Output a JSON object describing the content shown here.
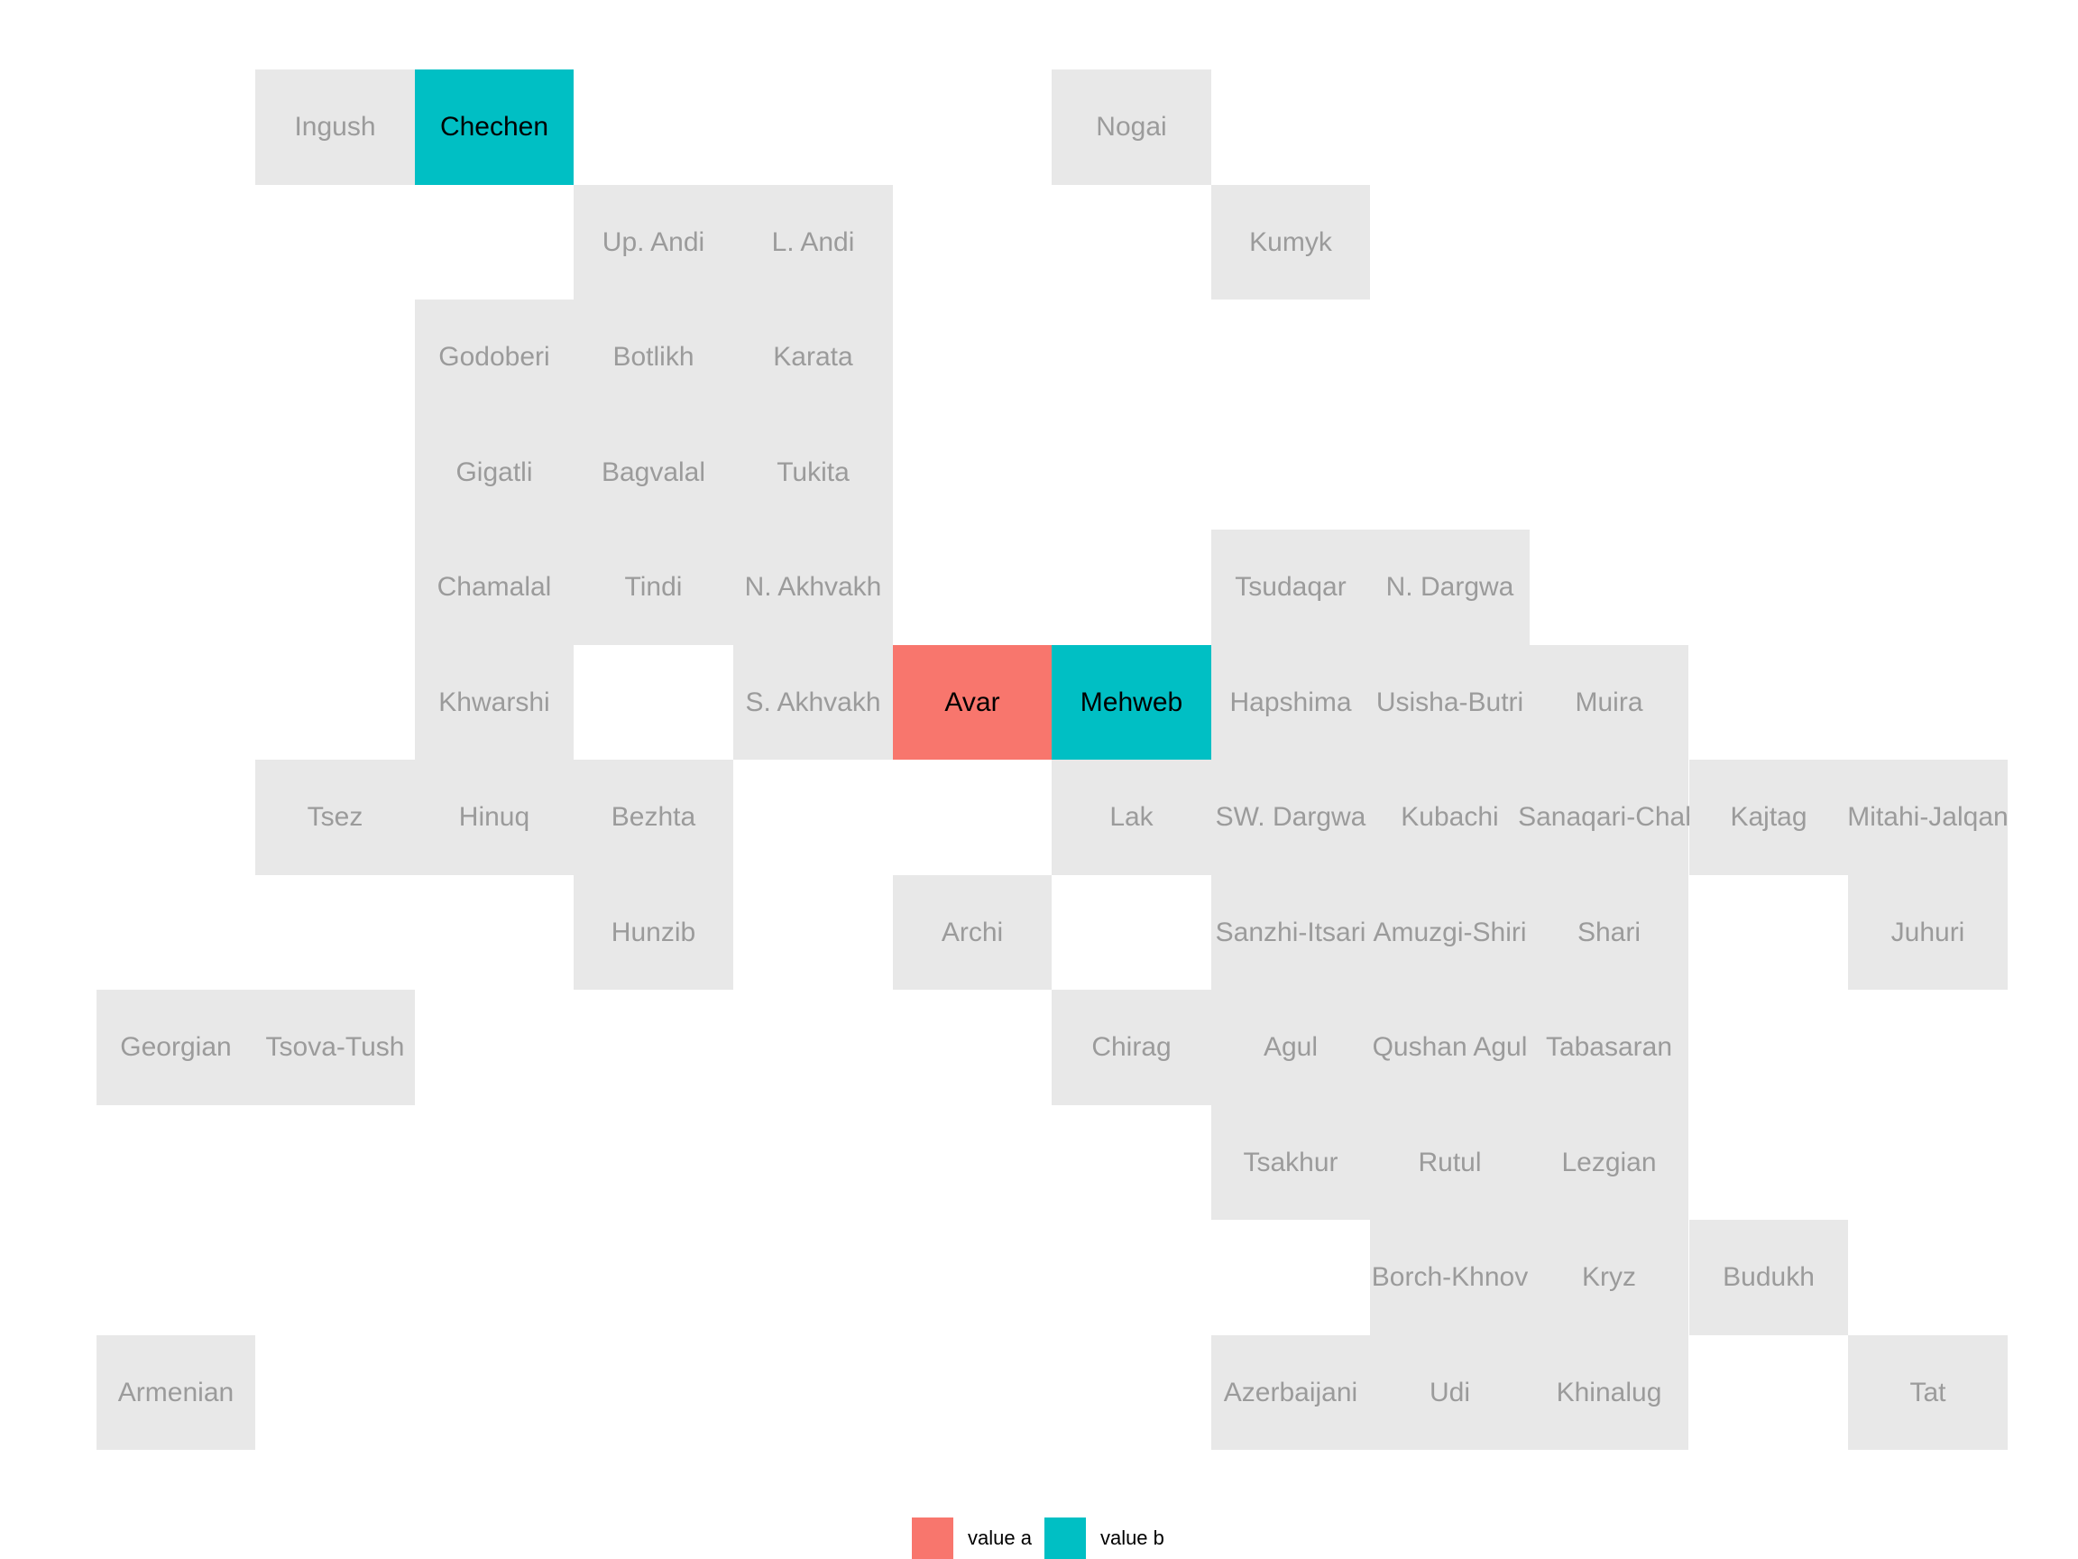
{
  "chart_data": {
    "type": "heatmap",
    "title": "",
    "columns": 12,
    "rows": 12,
    "legend": {
      "position": "bottom",
      "entries": [
        {
          "label": "value a",
          "color": "#f8766d"
        },
        {
          "label": "value b",
          "color": "#00bfc4"
        }
      ]
    },
    "default_color": "#e8e8e8",
    "cells": [
      {
        "name": "Ingush",
        "col": 2,
        "row": 1,
        "value": null
      },
      {
        "name": "Chechen",
        "col": 3,
        "row": 1,
        "value": "value b"
      },
      {
        "name": "Nogai",
        "col": 7,
        "row": 1,
        "value": null
      },
      {
        "name": "Up. Andi",
        "col": 4,
        "row": 2,
        "value": null
      },
      {
        "name": "L. Andi",
        "col": 5,
        "row": 2,
        "value": null
      },
      {
        "name": "Kumyk",
        "col": 8,
        "row": 2,
        "value": null
      },
      {
        "name": "Godoberi",
        "col": 3,
        "row": 3,
        "value": null
      },
      {
        "name": "Botlikh",
        "col": 4,
        "row": 3,
        "value": null
      },
      {
        "name": "Karata",
        "col": 5,
        "row": 3,
        "value": null
      },
      {
        "name": "Gigatli",
        "col": 3,
        "row": 4,
        "value": null
      },
      {
        "name": "Bagvalal",
        "col": 4,
        "row": 4,
        "value": null
      },
      {
        "name": "Tukita",
        "col": 5,
        "row": 4,
        "value": null
      },
      {
        "name": "Chamalal",
        "col": 3,
        "row": 5,
        "value": null
      },
      {
        "name": "Tindi",
        "col": 4,
        "row": 5,
        "value": null
      },
      {
        "name": "N. Akhvakh",
        "col": 5,
        "row": 5,
        "value": null
      },
      {
        "name": "Tsudaqar",
        "col": 8,
        "row": 5,
        "value": null
      },
      {
        "name": "N. Dargwa",
        "col": 9,
        "row": 5,
        "value": null
      },
      {
        "name": "Khwarshi",
        "col": 3,
        "row": 6,
        "value": null
      },
      {
        "name": "S. Akhvakh",
        "col": 5,
        "row": 6,
        "value": null
      },
      {
        "name": "Avar",
        "col": 6,
        "row": 6,
        "value": "value a"
      },
      {
        "name": "Mehweb",
        "col": 7,
        "row": 6,
        "value": "value b"
      },
      {
        "name": "Hapshima",
        "col": 8,
        "row": 6,
        "value": null
      },
      {
        "name": "Usisha-Butri",
        "col": 9,
        "row": 6,
        "value": null
      },
      {
        "name": "Muira",
        "col": 10,
        "row": 6,
        "value": null
      },
      {
        "name": "Tsez",
        "col": 2,
        "row": 7,
        "value": null
      },
      {
        "name": "Hinuq",
        "col": 3,
        "row": 7,
        "value": null
      },
      {
        "name": "Bezhta",
        "col": 4,
        "row": 7,
        "value": null
      },
      {
        "name": "Lak",
        "col": 7,
        "row": 7,
        "value": null
      },
      {
        "name": "SW. Dargwa",
        "col": 8,
        "row": 7,
        "value": null
      },
      {
        "name": "Kubachi",
        "col": 9,
        "row": 7,
        "value": null
      },
      {
        "name": "Sanaqari-Chah",
        "col": 10,
        "row": 7,
        "value": null
      },
      {
        "name": "Kajtag",
        "col": 11,
        "row": 7,
        "value": null
      },
      {
        "name": "Mitahi-Jalqan",
        "col": 12,
        "row": 7,
        "value": null
      },
      {
        "name": "Hunzib",
        "col": 4,
        "row": 8,
        "value": null
      },
      {
        "name": "Archi",
        "col": 6,
        "row": 8,
        "value": null
      },
      {
        "name": "Sanzhi-Itsari",
        "col": 8,
        "row": 8,
        "value": null
      },
      {
        "name": "Amuzgi-Shiri",
        "col": 9,
        "row": 8,
        "value": null
      },
      {
        "name": "Shari",
        "col": 10,
        "row": 8,
        "value": null
      },
      {
        "name": "Juhuri",
        "col": 12,
        "row": 8,
        "value": null
      },
      {
        "name": "Georgian",
        "col": 1,
        "row": 9,
        "value": null
      },
      {
        "name": "Tsova-Tush",
        "col": 2,
        "row": 9,
        "value": null
      },
      {
        "name": "Chirag",
        "col": 7,
        "row": 9,
        "value": null
      },
      {
        "name": "Agul",
        "col": 8,
        "row": 9,
        "value": null
      },
      {
        "name": "Qushan Agul",
        "col": 9,
        "row": 9,
        "value": null
      },
      {
        "name": "Tabasaran",
        "col": 10,
        "row": 9,
        "value": null
      },
      {
        "name": "Tsakhur",
        "col": 8,
        "row": 10,
        "value": null
      },
      {
        "name": "Rutul",
        "col": 9,
        "row": 10,
        "value": null
      },
      {
        "name": "Lezgian",
        "col": 10,
        "row": 10,
        "value": null
      },
      {
        "name": "Borch-Khnov",
        "col": 9,
        "row": 11,
        "value": null
      },
      {
        "name": "Kryz",
        "col": 10,
        "row": 11,
        "value": null
      },
      {
        "name": "Budukh",
        "col": 11,
        "row": 11,
        "value": null
      },
      {
        "name": "Armenian",
        "col": 1,
        "row": 12,
        "value": null
      },
      {
        "name": "Azerbaijani",
        "col": 8,
        "row": 12,
        "value": null
      },
      {
        "name": "Udi",
        "col": 9,
        "row": 12,
        "value": null
      },
      {
        "name": "Khinalug",
        "col": 10,
        "row": 12,
        "value": null
      },
      {
        "name": "Tat",
        "col": 12,
        "row": 12,
        "value": null
      }
    ]
  }
}
